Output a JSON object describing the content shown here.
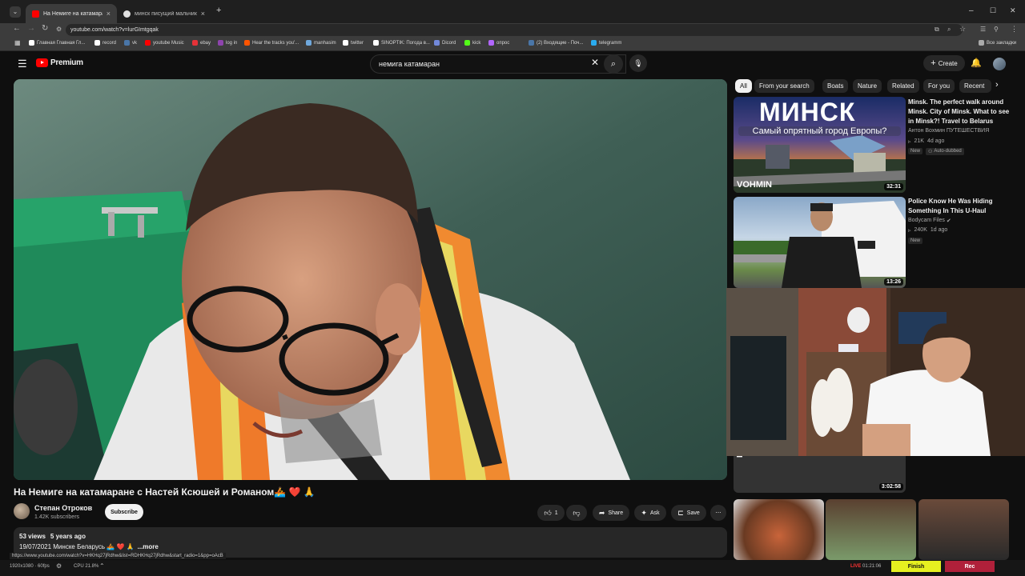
{
  "browser": {
    "tabs": [
      {
        "label": "На Немиге на катамаране с Н",
        "active": true,
        "favicon_color": "#ff0000"
      },
      {
        "label": "минск писущий мальчик - G",
        "active": false,
        "favicon_color": "#e0e0e0"
      }
    ],
    "new_tab": "+",
    "window_controls": [
      "–",
      "☐",
      "✕"
    ],
    "url": "youtube.com/watch?v=lurGImtgqak",
    "bookmarks": [
      {
        "label": "Главная Главная Гл...",
        "color": "#ffffff"
      },
      {
        "label": "record",
        "color": "#ffffff"
      },
      {
        "label": "vk",
        "color": "#4a76a8"
      },
      {
        "label": "youtube Music",
        "color": "#ff0000"
      },
      {
        "label": "ebay",
        "color": "#e53238"
      },
      {
        "label": "log in",
        "color": "#8e44ad"
      },
      {
        "label": "Hear the tracks you'...",
        "color": "#ff5500"
      },
      {
        "label": "manhasim",
        "color": "#6fa8dc"
      },
      {
        "label": "twitter",
        "color": "#ffffff"
      },
      {
        "label": "SINOPTIK: Погода в...",
        "color": "#ffffff"
      },
      {
        "label": "Dicord",
        "color": "#7289da"
      },
      {
        "label": "kick",
        "color": "#53fc18"
      },
      {
        "label": "опрос",
        "color": "#b266ff"
      },
      {
        "label": "(2) Входящие - Поч...",
        "color": "#4a76a8"
      },
      {
        "label": "telegramm",
        "color": "#2aabee"
      }
    ],
    "all_bookmarks": "Все закладки"
  },
  "youtube": {
    "logo_text": "Premium",
    "search_value": "немига катамаран",
    "create_label": "Create"
  },
  "video": {
    "title": "На Немиге на катамаране с Настей Ксюшей и Романом🚣 ❤️ 🙏",
    "channel": "Степан Отроков",
    "subscribers": "1.42K subscribers",
    "subscribe_label": "Subscribe",
    "like_count": "1",
    "share_label": "Share",
    "ask_label": "Ask",
    "save_label": "Save",
    "views": "53 views",
    "age": "5 years ago",
    "description": "19/07/2021 Минске Беларусь 🚣 ❤️ 🙏",
    "more_label": "...more"
  },
  "chips": [
    "All",
    "From your search",
    "Boats",
    "Nature",
    "Related",
    "For you",
    "Recent"
  ],
  "recommendations": [
    {
      "title": "Minsk. The perfect walk around Minsk. City of Minsk. What to see in Minsk?! Travel to Belarus",
      "channel": "Антон Вохмин ПУТЕШЕСТВИЯ",
      "views": "21K",
      "age": "4d ago",
      "badge_new": "New",
      "badge_dub": "Auto-dubbed",
      "duration": "32:31",
      "thumb_text_main": "МИНСК",
      "thumb_text_sub": "Самый опрятный город Европы?",
      "thumb_text_brand": "VOHMIN"
    },
    {
      "title": "Police Know He Was Hiding Something In This U-Haul",
      "channel": "Bodycam Files",
      "views": "240K",
      "age": "1d ago",
      "badge_new": "New",
      "duration": "13:26"
    },
    {
      "duration": "3:02:58",
      "thumb_text": "Play"
    }
  ],
  "statusbar": {
    "link_preview": "https://www.youtube.com/watch?v=HKHq27jRdhw&list=RDHKHq27jRdhw&start_radio=1&pp=oAcB",
    "resolution": "1920x1080 · 60fps",
    "cpu": "CPU 21.8%",
    "live_label": "LIVE",
    "live_time": "01:21:06",
    "finish_label": "Finish",
    "rec_label": "Rec"
  }
}
